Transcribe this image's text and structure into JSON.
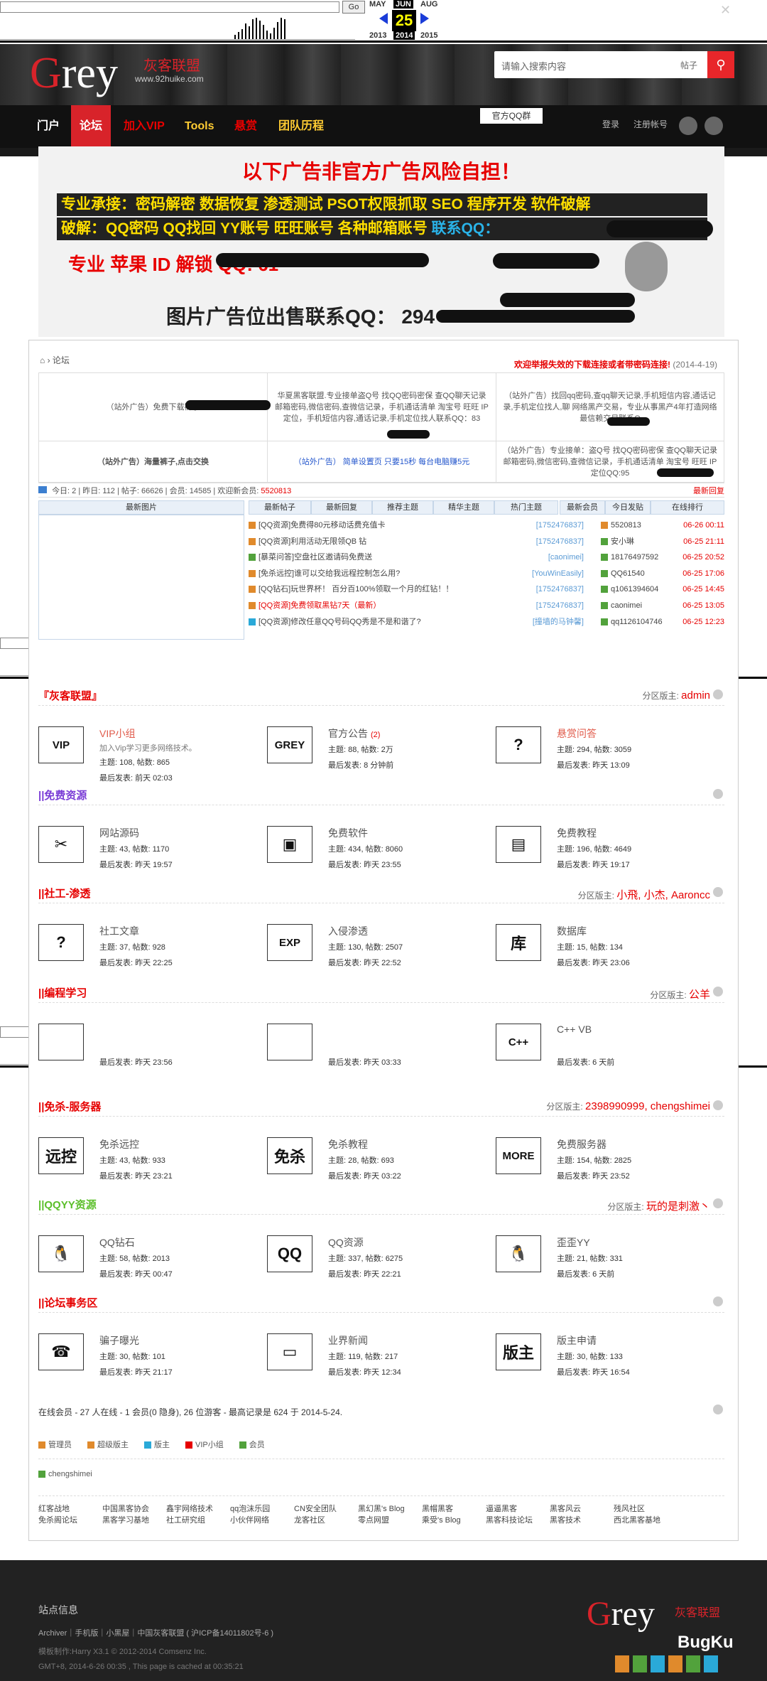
{
  "wayback": {
    "go": "Go",
    "months": [
      "MAY",
      "JUN",
      "AUG"
    ],
    "day": "25",
    "years": [
      "2013",
      "2014",
      "2015"
    ]
  },
  "header": {
    "logo_main": "Grey",
    "logo_cn": "灰客联盟",
    "logo_url": "www.92huike.com",
    "search_placeholder": "请输入搜索内容",
    "search_type": "帖子",
    "nav": [
      {
        "label": "门户",
        "color": "#ffffff"
      },
      {
        "label": "论坛",
        "color": "#ffffff",
        "active": true
      },
      {
        "label": "加入VIP",
        "color": "#e80000"
      },
      {
        "label": "Tools",
        "color": "#ffcc33"
      },
      {
        "label": "悬赏",
        "color": "#e80000"
      },
      {
        "label": "团队历程",
        "color": "#ffcc33"
      }
    ],
    "qq_group": "官方QQ群",
    "login": "登录",
    "register": "注册帐号"
  },
  "ad": {
    "title": "以下广告非官方广告风险自担！",
    "row1": "专业承接：密码解密 数据恢复 渗透测试 PSOT权限抓取 SEO 程序开发 软件破解",
    "row2": "破解：QQ密码 QQ找回 YY账号 旺旺账号 各种邮箱账号",
    "row2_qq": "联系QQ：",
    "line3": "专业 苹果 ID 解锁 QQ: 61",
    "line4": "图片广告位出售联系QQ： 294"
  },
  "forum": {
    "breadcrumb": "论坛",
    "notice": "欢迎举报失效的下载连接或者带密码连接!",
    "notice_date": "(2014-4-19)",
    "site_ads": [
      "（站外广告）免费下载裤子",
      "华夏黑客联盟.专业接单盗Q号 找QQ密码密保 查QQ聊天记录 邮箱密码,微信密码,查微信记录，手机通话清单 淘宝号 旺旺 IP定位，手机短信内容,通话记录,手机定位找人联系QQ：83",
      "（站外广告）找回qq密码,查qq聊天记录,手机短信内容,通话记录,手机定位找人,聊 网络黑产交易，专业从事黑产4年打造网络最信赖交易联系Q",
      "（站外广告）海量裤子,点击交换",
      "（站外广告） 简单设置页 只要15秒 每台电脑赚5元",
      "（站外广告）专业接单：盗Q号 找QQ密码密保 查QQ聊天记录 邮箱密码,微信密码,查微信记录，手机通话清单 淘宝号 旺旺 IP定位QQ:95"
    ],
    "stats": {
      "today": "今日: 2",
      "yesterday": "昨日: 112",
      "posts": "帖子: 66626",
      "members": "会员: 14585",
      "welcome": "欢迎新会员:",
      "newest": "5520813",
      "rank": "最新回复"
    },
    "tabs": [
      "最新图片",
      "最新帖子",
      "最新回复",
      "推荐主题",
      "精华主题",
      "热门主题",
      "最新会员",
      "今日发贴",
      "在线排行"
    ],
    "threads": [
      {
        "t": "[QQ资源]免费得80元移动话费充值卡",
        "a": "[1752476837]",
        "c": "#e08a2c"
      },
      {
        "t": "[QQ资源]利用活动无限领QB 钻",
        "a": "[1752476837]",
        "c": "#e08a2c"
      },
      {
        "t": "[暴菜问答]空盘社区邀请码免费送",
        "a": "[caonimei]",
        "c": "#52a23c"
      },
      {
        "t": "[免杀远控]谁可以交给我远程控制怎么用?",
        "a": "[YouWinEasily]",
        "c": "#e08a2c"
      },
      {
        "t": "[QQ钻石]玩世界杯！ 百分百100%领取一个月的红钻！！",
        "a": "[1752476837]",
        "c": "#e08a2c"
      },
      {
        "t": "[QQ资源]免费领取黑钻7天（最新）",
        "a": "[1752476837]",
        "c": "#e08a2c",
        "red": true
      },
      {
        "t": "[QQ资源]修改任意QQ号码QQ秀是不是和谐了?",
        "a": "[撞墙的马钟馨]",
        "c": "#2aa9d8"
      }
    ],
    "members": [
      {
        "n": "5520813",
        "d": "06-26 00:11"
      },
      {
        "n": "安小琳",
        "d": "06-25 21:11"
      },
      {
        "n": "18176497592",
        "d": "06-25 20:52"
      },
      {
        "n": "QQ61540",
        "d": "06-25 17:06"
      },
      {
        "n": "q1061394604",
        "d": "06-25 14:45"
      },
      {
        "n": "caonimei",
        "d": "06-25 13:05"
      },
      {
        "n": "qq1126104746",
        "d": "06-25 12:23"
      }
    ],
    "sections": [
      {
        "title": "『灰客联盟』",
        "color": "#e60000",
        "mod_label": "分区版主:",
        "mods": "admin",
        "items": [
          {
            "icon": "VIP",
            "name": "VIP小组",
            "red": true,
            "desc": "加入Vip学习更多网络技术。",
            "meta": "主题: 108, 帖数: 865",
            "last": "最后发表: 前天 02:03"
          },
          {
            "icon": "GREY",
            "name": "官方公告",
            "badge": "(2)",
            "meta": "主题: 88, 帖数: 2万",
            "last": "最后发表: 8 分钟前"
          },
          {
            "icon": "?",
            "name": "悬赏问答",
            "red": true,
            "meta": "主题: 294, 帖数: 3059",
            "last": "最后发表: 昨天 13:09"
          }
        ]
      },
      {
        "title": "||免费资源",
        "color": "#7a3dd6",
        "mod_label": "",
        "mods": "",
        "items": [
          {
            "icon": "✂",
            "name": "网站源码",
            "meta": "主题: 43, 帖数: 1170",
            "last": "最后发表: 昨天 19:57"
          },
          {
            "icon": "▣",
            "name": "免费软件",
            "meta": "主题: 434, 帖数: 8060",
            "last": "最后发表: 昨天 23:55"
          },
          {
            "icon": "▤",
            "name": "免费教程",
            "meta": "主题: 196, 帖数: 4649",
            "last": "最后发表: 昨天 19:17"
          }
        ]
      },
      {
        "title": "||社工-渗透",
        "color": "#e60000",
        "mod_label": "分区版主:",
        "mods": "小飛, 小杰, Aaroncc",
        "items": [
          {
            "icon": "?",
            "name": "社工文章",
            "meta": "主题: 37, 帖数: 928",
            "last": "最后发表: 昨天 22:25"
          },
          {
            "icon": "EXP",
            "name": "入侵渗透",
            "meta": "主题: 130, 帖数: 2507",
            "last": "最后发表: 昨天 22:52"
          },
          {
            "icon": "库",
            "name": "数据库",
            "meta": "主题: 15, 帖数: 134",
            "last": "最后发表: 昨天 23:06"
          }
        ]
      },
      {
        "title": "||编程学习",
        "color": "#e60000",
        "mod_label": "分区版主:",
        "mods": "公羊",
        "items": [
          {
            "icon": "",
            "name": "",
            "meta": "",
            "last": "最后发表: 昨天 23:56"
          },
          {
            "icon": "",
            "name": "",
            "meta": "",
            "last": "最后发表: 昨天 03:33"
          },
          {
            "icon": "C++",
            "name": "C++ VB",
            "meta": "",
            "last": "最后发表: 6 天前"
          }
        ]
      },
      {
        "title": "||免杀-服务器",
        "color": "#e60000",
        "mod_label": "分区版主:",
        "mods": "2398990999, chengshimei",
        "items": [
          {
            "icon": "远控",
            "name": "免杀远控",
            "meta": "主题: 43, 帖数: 933",
            "last": "最后发表: 昨天 23:21"
          },
          {
            "icon": "免杀",
            "name": "免杀教程",
            "meta": "主题: 28, 帖数: 693",
            "last": "最后发表: 昨天 03:22"
          },
          {
            "icon": "MORE",
            "name": "免费服务器",
            "meta": "主题: 154, 帖数: 2825",
            "last": "最后发表: 昨天 23:52"
          }
        ]
      },
      {
        "title": "||QQYY资源",
        "color": "#5bbf2a",
        "mod_label": "分区版主:",
        "mods": "玩的是刺激丶",
        "items": [
          {
            "icon": "🐧",
            "name": "QQ钻石",
            "meta": "主题: 58, 帖数: 2013",
            "last": "最后发表: 昨天 00:47"
          },
          {
            "icon": "QQ",
            "name": "QQ资源",
            "meta": "主题: 337, 帖数: 6275",
            "last": "最后发表: 昨天 22:21"
          },
          {
            "icon": "🐧",
            "name": "歪歪YY",
            "meta": "主题: 21, 帖数: 331",
            "last": "最后发表: 6 天前"
          }
        ]
      },
      {
        "title": "||论坛事务区",
        "color": "#e60000",
        "mod_label": "",
        "mods": "",
        "items": [
          {
            "icon": "☎",
            "name": "骗子曝光",
            "meta": "主题: 30, 帖数: 101",
            "last": "最后发表: 昨天 21:17"
          },
          {
            "icon": "▭",
            "name": "业界新闻",
            "meta": "主题: 119, 帖数: 217",
            "last": "最后发表: 昨天 12:34"
          },
          {
            "icon": "版主",
            "name": "版主申请",
            "meta": "主题: 30, 帖数: 133",
            "last": "最后发表: 昨天 16:54"
          }
        ]
      }
    ],
    "online": "在线会员 - 27 人在线 - 1 会员(0 隐身), 26 位游客 - 最高记录是 624 于 2014-5-24.",
    "legend": [
      "管理员",
      "超级版主",
      "版主",
      "VIP小组",
      "会员"
    ],
    "online_user": "chengshimei",
    "links": [
      "红客战地",
      "中国黑客协会",
      "鑫宇网络技术",
      "qq泡沫乐园",
      "CN安全团队",
      "黑幻黑's Blog",
      "黑帽黑客",
      "逼逼黑客",
      "黑客风云",
      "残风社区",
      "免杀阁论坛",
      "黑客学习基地",
      "社工研究组",
      "小伙伴网络",
      "龙客社区",
      "零点网盟",
      "乘受's Blog",
      "黑客科技论坛",
      "黑客技术",
      "西北黑客基地"
    ]
  },
  "footer": {
    "title": "站点信息",
    "links": "Archiver｜手机版｜小黑屋｜中国灰客联盟 ( 沪ICP备14011802号-6 )",
    "template": "模板制作:Harry X3.1 © 2012-2014 Comsenz Inc.",
    "time": "GMT+8, 2014-6-26 00:35 , This page is cached at 00:35:21",
    "logo": "Grey",
    "logo_cn": "灰客联盟",
    "watermark": "BugKu"
  }
}
